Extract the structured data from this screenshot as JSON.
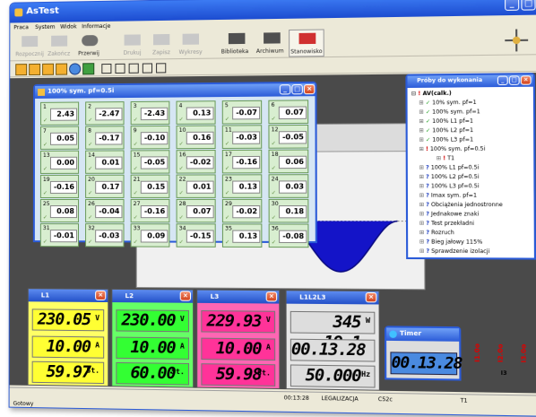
{
  "window": {
    "title": "AsTest",
    "min": "_",
    "max": "□",
    "close": "×"
  },
  "menu": [
    "Praca",
    "System",
    "Widok",
    "Informacje"
  ],
  "toolbar": {
    "buttons": [
      "Rozpocznij",
      "Zakończ",
      "Przerwij",
      "Drukuj",
      "Zapisz",
      "Wykresy",
      "Biblioteka",
      "Archiwum",
      "Stanowisko"
    ]
  },
  "grid_window": {
    "title": "100% sym. pf=0.5i",
    "cells": [
      {
        "n": "1",
        "v": "2.43"
      },
      {
        "n": "2",
        "v": "-2.47"
      },
      {
        "n": "3",
        "v": "-2.43"
      },
      {
        "n": "4",
        "v": "0.13"
      },
      {
        "n": "5",
        "v": "-0.07"
      },
      {
        "n": "6",
        "v": "0.07"
      },
      {
        "n": "7",
        "v": "0.05"
      },
      {
        "n": "8",
        "v": "-0.17"
      },
      {
        "n": "9",
        "v": "-0.10"
      },
      {
        "n": "10",
        "v": "0.16"
      },
      {
        "n": "11",
        "v": "-0.03"
      },
      {
        "n": "12",
        "v": "-0.05"
      },
      {
        "n": "13",
        "v": "0.00"
      },
      {
        "n": "14",
        "v": "0.01"
      },
      {
        "n": "15",
        "v": "-0.05"
      },
      {
        "n": "16",
        "v": "-0.02"
      },
      {
        "n": "17",
        "v": "-0.16"
      },
      {
        "n": "18",
        "v": "0.06"
      },
      {
        "n": "19",
        "v": "-0.16"
      },
      {
        "n": "20",
        "v": "0.17"
      },
      {
        "n": "21",
        "v": "0.15"
      },
      {
        "n": "22",
        "v": "0.01"
      },
      {
        "n": "23",
        "v": "0.13"
      },
      {
        "n": "24",
        "v": "0.03"
      },
      {
        "n": "25",
        "v": "0.08"
      },
      {
        "n": "26",
        "v": "-0.04"
      },
      {
        "n": "27",
        "v": "-0.16"
      },
      {
        "n": "28",
        "v": "0.07"
      },
      {
        "n": "29",
        "v": "-0.02"
      },
      {
        "n": "30",
        "v": "0.18"
      },
      {
        "n": "31",
        "v": "-0.01"
      },
      {
        "n": "32",
        "v": "-0.03"
      },
      {
        "n": "33",
        "v": "0.09"
      },
      {
        "n": "34",
        "v": "-0.15"
      },
      {
        "n": "35",
        "v": "0.13"
      },
      {
        "n": "36",
        "v": "-0.08"
      }
    ]
  },
  "tree_window": {
    "title": "Próby do wykonania",
    "root": "AV(calk.)",
    "items": [
      {
        "mark": "✓",
        "text": "10% sym. pf=1"
      },
      {
        "mark": "✓",
        "text": "100% sym. pf=1"
      },
      {
        "mark": "✓",
        "text": "100% L1 pf=1"
      },
      {
        "mark": "✓",
        "text": "100% L2 pf=1"
      },
      {
        "mark": "✓",
        "text": "100% L3 pf=1"
      },
      {
        "mark": "!",
        "text": "100% sym. pf=0.5i"
      },
      {
        "mark": "!",
        "text": "T1"
      },
      {
        "mark": "?",
        "text": "100% L1 pf=0.5i"
      },
      {
        "mark": "?",
        "text": "100% L2 pf=0.5i"
      },
      {
        "mark": "?",
        "text": "100% L3 pf=0.5i"
      },
      {
        "mark": "?",
        "text": "Imax sym. pf=1"
      },
      {
        "mark": "?",
        "text": "Obciążenia jednostronne"
      },
      {
        "mark": "?",
        "text": "Jednakowe znaki"
      },
      {
        "mark": "?",
        "text": "Test przekładni"
      },
      {
        "mark": "?",
        "text": "Rozruch"
      },
      {
        "mark": "?",
        "text": "Bieg jałowy 115%"
      },
      {
        "mark": "?",
        "text": "Sprawdzenie izolacji"
      }
    ]
  },
  "meters": [
    {
      "title": "L1",
      "color": "#ffff33",
      "bg": "#ffff66",
      "r1": "230.05",
      "u1": "V",
      "r2": "10.00",
      "u2": "A",
      "r3": "59.97",
      "u3": "St."
    },
    {
      "title": "L2",
      "color": "#33ff33",
      "bg": "#66ff66",
      "r1": "230.00",
      "u1": "V",
      "r2": "10.00",
      "u2": "A",
      "r3": "60.00",
      "u3": "St."
    },
    {
      "title": "L3",
      "color": "#ff3399",
      "bg": "#ff66b3",
      "r1": "229.93",
      "u1": "V",
      "r2": "10.00",
      "u2": "A",
      "r3": "59.98",
      "u3": "St."
    },
    {
      "title": "L1L2L3",
      "color": "#dddddd",
      "bg": "#e6e6e6",
      "r1": "345 19.1",
      "u1": "W",
      "r2": "00.13.28",
      "u2": "",
      "r3": "50.000",
      "u3": "Hz"
    }
  ],
  "timer": {
    "title": "Timer",
    "value": "00.13.28"
  },
  "side_labels": [
    "I1.0o",
    "I2.0o",
    "I3.0o",
    "I3"
  ],
  "statusbar": {
    "left": "Gotowy",
    "time": "00:13:28",
    "mode": "LEGALIZACJA",
    "code": "C52c",
    "t1": "T1"
  },
  "colors": {
    "titlebar": "#2b5bd8",
    "accent_wave": "#1414c8",
    "dark_bg": "#404040",
    "panel_bg": "#d4d0c8"
  }
}
